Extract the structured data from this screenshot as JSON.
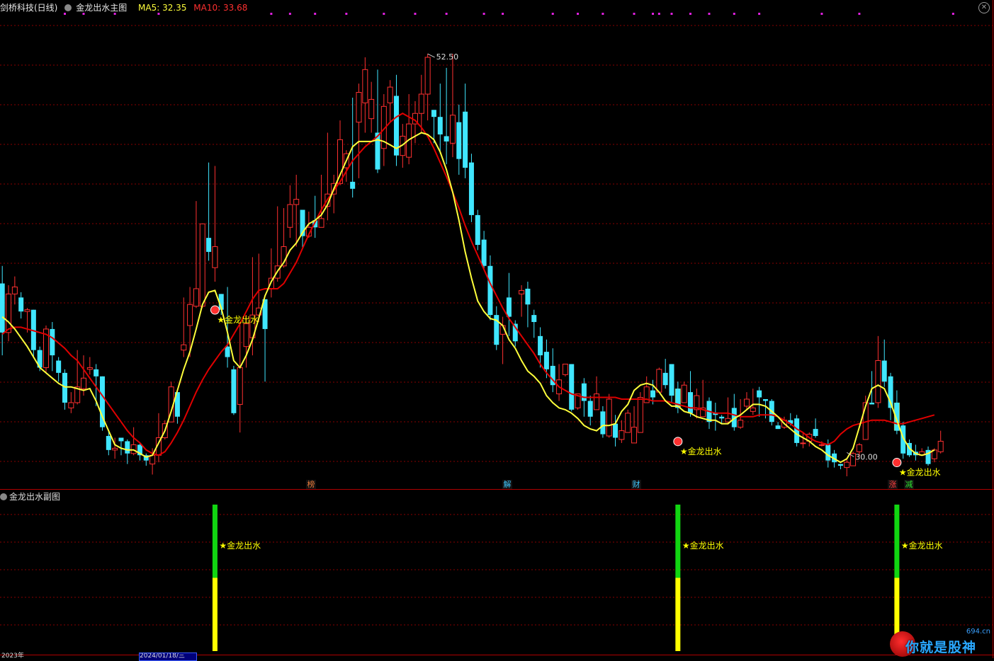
{
  "header": {
    "stock_name": "剑桥科技(日线)",
    "indicator_name": "金龙出水主图",
    "ma5_label": "MA5: 32.35",
    "ma10_label": "MA10: 33.68"
  },
  "sub_panel": {
    "title": "金龙出水副图"
  },
  "price_marks": {
    "high": "52.50",
    "low": "30.00"
  },
  "signals": {
    "label": "★金龙出水"
  },
  "event_badges": [
    "榜",
    "解",
    "财",
    "涨",
    "减"
  ],
  "bottom_axis": {
    "left_label": "2023年",
    "date_box": "2024/01/18/三"
  },
  "watermark": {
    "site": "694.cn",
    "text": "你就是股神"
  },
  "colors": {
    "up": "#ff3030",
    "down": "#40e6ff",
    "ma5": "#ffff3b",
    "ma10": "#e00000",
    "grid": "#8a0000",
    "signal_bar": "#ffcc00",
    "sub_green": "#11d611",
    "sub_yellow": "#ffff00"
  },
  "chart_data": {
    "type": "candlestick",
    "price_range": [
      28.4,
      54.6
    ],
    "high": 52.5,
    "low": 30.0,
    "candles": [
      [
        39.4,
        36.6,
        35.3,
        40.4
      ],
      [
        36.6,
        38.8,
        36.1,
        39.3
      ],
      [
        38.8,
        39.2,
        38.2,
        39.8
      ],
      [
        38.6,
        37.8,
        37.4,
        38.9
      ],
      [
        37.8,
        37.9,
        36.6,
        38.0
      ],
      [
        37.9,
        35.6,
        35.2,
        37.9
      ],
      [
        35.6,
        34.6,
        34.4,
        35.8
      ],
      [
        34.6,
        36.8,
        34.3,
        37.0
      ],
      [
        36.8,
        35.3,
        34.4,
        37.2
      ],
      [
        35.0,
        34.3,
        33.8,
        35.2
      ],
      [
        34.3,
        32.6,
        32.2,
        34.5
      ],
      [
        32.3,
        32.6,
        32.0,
        33.2
      ],
      [
        32.6,
        33.5,
        32.5,
        35.6
      ],
      [
        33.4,
        34.0,
        33.0,
        35.3
      ],
      [
        34.5,
        34.6,
        34.2,
        35.2
      ],
      [
        34.5,
        34.1,
        32.4,
        34.8
      ],
      [
        34.1,
        31.2,
        31.0,
        34.1
      ],
      [
        30.7,
        29.9,
        29.6,
        31.0
      ],
      [
        29.9,
        30.0,
        29.4,
        30.6
      ],
      [
        30.6,
        30.4,
        29.6,
        30.6
      ],
      [
        30.4,
        29.7,
        29.1,
        30.5
      ],
      [
        29.7,
        30.2,
        29.6,
        31.2
      ],
      [
        30.2,
        29.6,
        29.3,
        30.3
      ],
      [
        29.6,
        29.3,
        29.0,
        29.7
      ],
      [
        29.1,
        29.6,
        28.5,
        30.0
      ],
      [
        29.6,
        30.6,
        29.2,
        32.0
      ],
      [
        30.6,
        31.4,
        30.5,
        31.6
      ],
      [
        31.5,
        33.5,
        32.2,
        33.8
      ],
      [
        33.2,
        31.8,
        31.4,
        33.3
      ],
      [
        35.6,
        35.9,
        35.2,
        38.6
      ],
      [
        37.0,
        38.2,
        35.2,
        39.2
      ],
      [
        38.1,
        39.1,
        38.0,
        44.1
      ],
      [
        38.1,
        42.8,
        38.0,
        42.0
      ],
      [
        42.0,
        41.2,
        40.7,
        46.3
      ],
      [
        40.3,
        41.5,
        39.5,
        46.1
      ],
      [
        38.8,
        37.9,
        37.6,
        38.8
      ],
      [
        35.8,
        35.2,
        34.6,
        39.2
      ],
      [
        34.5,
        32.0,
        31.9,
        34.7
      ],
      [
        32.5,
        34.6,
        30.9,
        37.2
      ],
      [
        35.8,
        37.1,
        34.6,
        37.6
      ],
      [
        36.3,
        37.6,
        35.3,
        40.9
      ],
      [
        37.6,
        38.0,
        37.2,
        41.1
      ],
      [
        38.5,
        36.8,
        33.8,
        37.8
      ],
      [
        39.1,
        39.7,
        38.6,
        41.4
      ],
      [
        39.7,
        40.4,
        39.5,
        43.8
      ],
      [
        40.4,
        41.5,
        40.3,
        43.7
      ],
      [
        42.6,
        43.9,
        42.0,
        45.0
      ],
      [
        43.9,
        44.2,
        41.5,
        45.6
      ],
      [
        43.6,
        42.1,
        41.4,
        42.4
      ],
      [
        42.1,
        42.6,
        42.0,
        43.5
      ],
      [
        43.0,
        42.6,
        42.0,
        44.4
      ],
      [
        42.6,
        43.1,
        42.8,
        45.6
      ],
      [
        43.8,
        44.5,
        43.0,
        48.0
      ],
      [
        44.5,
        45.1,
        43.4,
        45.6
      ],
      [
        45.1,
        47.6,
        45.0,
        48.7
      ],
      [
        46.0,
        46.8,
        45.2,
        47.0
      ],
      [
        45.2,
        44.8,
        44.3,
        50.0
      ],
      [
        48.6,
        50.3,
        45.4,
        50.8
      ],
      [
        49.7,
        51.6,
        48.0,
        52.3
      ],
      [
        48.8,
        49.9,
        48.0,
        50.9
      ],
      [
        48.0,
        45.9,
        45.7,
        51.6
      ],
      [
        47.1,
        49.5,
        46.1,
        50.2
      ],
      [
        49.7,
        50.6,
        48.6,
        51.0
      ],
      [
        50.1,
        46.7,
        46.1,
        51.3
      ],
      [
        46.7,
        47.8,
        46.0,
        48.5
      ],
      [
        46.6,
        48.5,
        46.2,
        50.2
      ],
      [
        48.5,
        49.1,
        47.4,
        49.8
      ],
      [
        49.1,
        50.2,
        48.0,
        51.3
      ],
      [
        50.2,
        52.3,
        48.7,
        52.5
      ],
      [
        49.3,
        48.9,
        47.4,
        49.3
      ],
      [
        48.9,
        47.9,
        46.8,
        50.8
      ],
      [
        47.8,
        47.5,
        46.2,
        51.7
      ],
      [
        47.4,
        49.0,
        46.6,
        52.5
      ],
      [
        48.6,
        46.5,
        45.6,
        49.6
      ],
      [
        49.2,
        46.0,
        45.4,
        50.8
      ],
      [
        46.3,
        43.3,
        42.9,
        46.8
      ],
      [
        43.3,
        41.6,
        41.3,
        43.6
      ],
      [
        41.9,
        40.4,
        40.2,
        42.4
      ],
      [
        40.4,
        37.6,
        37.3,
        41.0
      ],
      [
        37.6,
        35.9,
        35.6,
        38.1
      ],
      [
        36.5,
        37.0,
        34.8,
        37.5
      ],
      [
        38.6,
        37.5,
        36.4,
        40.0
      ],
      [
        37.1,
        36.1,
        35.8,
        37.3
      ],
      [
        38.8,
        39.0,
        37.5,
        39.3
      ],
      [
        39.1,
        38.2,
        36.9,
        39.5
      ],
      [
        37.6,
        37.2,
        36.3,
        37.9
      ],
      [
        36.4,
        35.3,
        34.6,
        36.9
      ],
      [
        35.5,
        34.5,
        34.0,
        36.2
      ],
      [
        34.7,
        33.6,
        33.2,
        35.7
      ],
      [
        33.1,
        33.9,
        32.7,
        34.8
      ],
      [
        34.2,
        34.8,
        34.1,
        34.5
      ],
      [
        34.8,
        32.2,
        32.1,
        34.8
      ],
      [
        32.3,
        33.1,
        32.2,
        33.1
      ],
      [
        33.7,
        32.7,
        31.8,
        34.0
      ],
      [
        32.7,
        31.8,
        31.3,
        33.0
      ],
      [
        32.2,
        33.1,
        32.5,
        34.1
      ],
      [
        32.1,
        30.8,
        30.6,
        32.4
      ],
      [
        30.7,
        32.8,
        30.6,
        33.1
      ],
      [
        31.4,
        30.6,
        30.1,
        31.9
      ],
      [
        30.5,
        31.0,
        30.3,
        31.6
      ],
      [
        30.9,
        32.0,
        31.2,
        32.2
      ],
      [
        30.3,
        31.2,
        30.6,
        32.4
      ],
      [
        30.9,
        32.9,
        30.9,
        33.2
      ],
      [
        32.6,
        33.5,
        32.8,
        34.1
      ],
      [
        33.3,
        32.9,
        32.5,
        33.9
      ],
      [
        33.2,
        34.5,
        33.6,
        34.6
      ],
      [
        34.3,
        33.6,
        33.4,
        35.1
      ],
      [
        34.8,
        33.0,
        32.6,
        34.8
      ],
      [
        33.4,
        32.3,
        32.0,
        33.8
      ],
      [
        32.6,
        33.6,
        32.6,
        33.8
      ],
      [
        33.2,
        32.0,
        31.8,
        34.4
      ],
      [
        32.2,
        33.0,
        31.7,
        33.4
      ],
      [
        31.8,
        32.3,
        32.3,
        33.9
      ],
      [
        32.7,
        31.5,
        31.1,
        32.9
      ],
      [
        32.0,
        31.9,
        31.0,
        32.6
      ],
      [
        31.8,
        31.7,
        31.4,
        31.9
      ],
      [
        31.5,
        31.7,
        31.4,
        32.9
      ],
      [
        32.3,
        31.2,
        31.0,
        33.1
      ],
      [
        31.2,
        31.6,
        31.1,
        32.8
      ],
      [
        32.4,
        32.8,
        32.2,
        33.2
      ],
      [
        32.1,
        32.3,
        31.9,
        33.4
      ],
      [
        33.3,
        32.9,
        31.8,
        33.5
      ],
      [
        32.8,
        32.7,
        31.7,
        32.8
      ],
      [
        32.7,
        31.5,
        31.3,
        32.8
      ],
      [
        31.3,
        31.1,
        31.1,
        31.5
      ],
      [
        31.2,
        31.6,
        31.1,
        31.8
      ],
      [
        31.6,
        31.4,
        31.3,
        32.0
      ],
      [
        31.7,
        30.3,
        30.1,
        31.9
      ],
      [
        30.3,
        30.3,
        30.0,
        30.9
      ],
      [
        30.4,
        30.8,
        30.1,
        30.9
      ],
      [
        31.1,
        30.7,
        30.6,
        31.7
      ],
      [
        30.2,
        30.2,
        30.1,
        30.4
      ],
      [
        30.2,
        29.3,
        28.9,
        30.5
      ],
      [
        29.7,
        29.2,
        28.9,
        29.9
      ],
      [
        29.1,
        29.0,
        28.8,
        29.1
      ],
      [
        28.9,
        29.2,
        28.4,
        29.4
      ],
      [
        29.0,
        29.7,
        29.0,
        29.8
      ],
      [
        29.8,
        30.2,
        29.5,
        30.3
      ],
      [
        30.5,
        32.6,
        32.2,
        33.0
      ],
      [
        32.6,
        32.5,
        32.6,
        34.4
      ],
      [
        32.6,
        35.0,
        32.3,
        36.4
      ],
      [
        35.0,
        33.8,
        33.5,
        36.2
      ],
      [
        34.1,
        32.3,
        31.6,
        34.3
      ],
      [
        32.6,
        31.0,
        30.8,
        33.3
      ],
      [
        31.3,
        29.7,
        29.4,
        31.5
      ],
      [
        30.3,
        29.6,
        29.5,
        30.5
      ],
      [
        29.8,
        29.6,
        29.3,
        30.2
      ],
      [
        29.6,
        29.8,
        29.7,
        30.0
      ],
      [
        29.9,
        29.1,
        29.0,
        30.1
      ],
      [
        29.4,
        29.9,
        29.2,
        30.0
      ],
      [
        29.8,
        30.4,
        29.7,
        31.0
      ]
    ],
    "ma5": [
      37.5,
      37.2,
      36.8,
      36.3,
      35.8,
      35.2,
      34.6,
      34.3,
      34.0,
      33.7,
      33.5,
      33.5,
      33.4,
      33.3,
      33.4,
      32.7,
      31.8,
      31.0,
      30.2,
      30.0,
      29.9,
      29.9,
      29.7,
      29.5,
      29.6,
      30.3,
      31.0,
      32.1,
      33.3,
      34.5,
      35.5,
      36.8,
      38.2,
      38.9,
      39.0,
      38.0,
      36.6,
      35.0,
      34.6,
      35.3,
      36.2,
      37.4,
      38.7,
      39.5,
      40.1,
      40.6,
      41.3,
      41.7,
      42.3,
      42.8,
      43.0,
      43.3,
      43.9,
      44.8,
      45.6,
      46.4,
      47.2,
      47.5,
      47.5,
      47.5,
      47.6,
      47.5,
      47.3,
      47.1,
      47.3,
      47.6,
      47.8,
      48.0,
      47.9,
      47.6,
      46.9,
      45.9,
      44.6,
      43.0,
      41.2,
      39.7,
      38.4,
      37.8,
      37.4,
      37.3,
      37.0,
      36.2,
      35.7,
      35.0,
      34.4,
      34.1,
      33.7,
      33.0,
      32.6,
      32.3,
      32.2,
      32.0,
      31.7,
      31.3,
      31.1,
      31.0,
      31.3,
      31.3,
      31.4,
      32.1,
      32.5,
      33.3,
      33.6,
      33.7,
      33.6,
      33.2,
      32.7,
      32.4,
      32.4,
      32.1,
      32.0,
      31.8,
      31.7,
      31.6,
      31.6,
      31.4,
      31.4,
      31.7,
      31.9,
      32.2,
      32.5,
      32.5,
      32.4,
      32.1,
      31.8,
      31.4,
      31.1,
      30.8,
      30.6,
      30.4,
      30.1,
      29.9,
      29.6,
      29.4,
      29.2,
      29.4,
      30.0,
      31.2,
      32.4,
      33.4,
      33.6,
      33.4,
      32.6,
      31.6,
      30.6,
      30.0,
      29.7,
      29.6,
      29.7,
      29.9
    ],
    "ma10": [
      36.5,
      36.8,
      36.9,
      36.9,
      36.8,
      36.7,
      36.6,
      36.5,
      36.3,
      36.0,
      35.7,
      35.3,
      35.0,
      34.5,
      34.0,
      33.5,
      33.0,
      32.5,
      32.0,
      31.5,
      31.0,
      30.6,
      30.3,
      29.9,
      29.7,
      29.6,
      29.8,
      30.3,
      30.9,
      31.6,
      32.4,
      33.2,
      33.9,
      34.5,
      35.0,
      35.5,
      35.9,
      36.5,
      37.1,
      37.8,
      38.5,
      39.0,
      39.1,
      39.1,
      39.1,
      39.4,
      40.0,
      40.6,
      41.4,
      42.2,
      42.9,
      43.6,
      44.2,
      44.7,
      45.2,
      45.8,
      46.4,
      46.8,
      47.2,
      47.5,
      47.8,
      48.2,
      48.6,
      48.9,
      49.1,
      48.9,
      48.7,
      48.3,
      47.8,
      47.1,
      46.3,
      45.5,
      44.6,
      43.7,
      42.7,
      41.8,
      41.0,
      40.2,
      39.4,
      38.7,
      38.0,
      37.4,
      36.9,
      36.4,
      35.9,
      35.4,
      34.8,
      34.3,
      33.9,
      33.5,
      33.3,
      33.1,
      33.0,
      32.9,
      32.9,
      32.9,
      32.9,
      32.9,
      32.9,
      32.8,
      32.8,
      32.8,
      32.8,
      32.8,
      32.7,
      32.7,
      32.7,
      32.6,
      32.5,
      32.4,
      32.3,
      32.3,
      32.2,
      32.1,
      32.0,
      32.0,
      32.0,
      31.9,
      31.8,
      31.8,
      31.8,
      31.9,
      31.9,
      31.9,
      31.8,
      31.6,
      31.4,
      31.1,
      30.9,
      30.6,
      30.4,
      30.3,
      30.2,
      30.4,
      30.8,
      31.1,
      31.3,
      31.4,
      31.5,
      31.6,
      31.6,
      31.6,
      31.5,
      31.4,
      31.4,
      31.5,
      31.6,
      31.7,
      31.8,
      31.9
    ],
    "signal_candles": [
      34,
      108,
      143
    ],
    "sub_chart": {
      "type": "bar",
      "signal_candles": [
        34,
        108,
        143
      ],
      "green_value": 2,
      "yellow_value": 4
    }
  }
}
